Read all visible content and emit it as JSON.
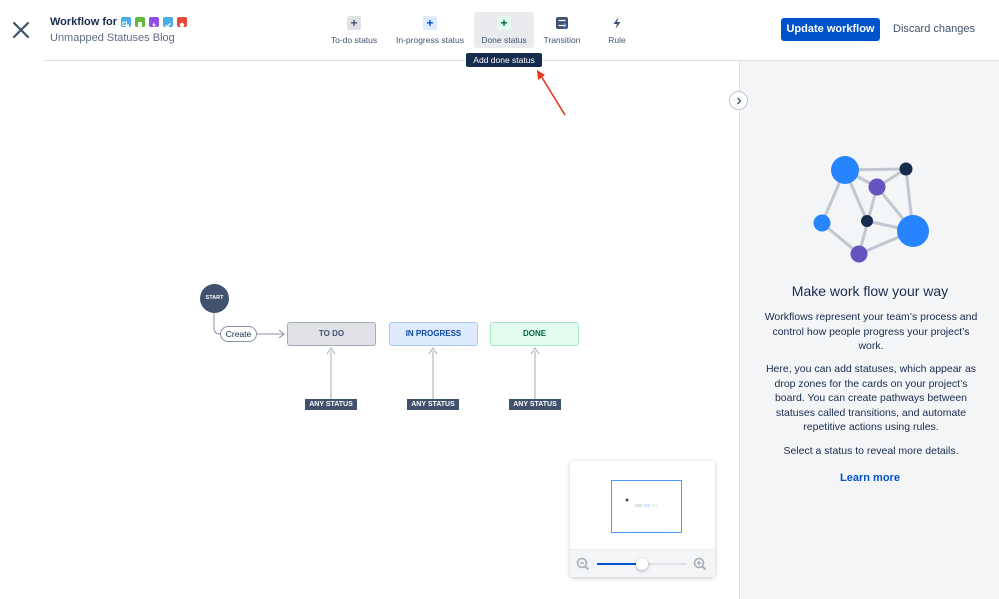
{
  "header": {
    "title": "Workflow for",
    "subtitle": "Unmapped Statuses Blog",
    "issue_type_icons": [
      {
        "name": "subtask-icon",
        "color": "#4bade8"
      },
      {
        "name": "story-icon",
        "color": "#63ba3c"
      },
      {
        "name": "epic-icon",
        "color": "#904ee2"
      },
      {
        "name": "task-icon",
        "color": "#4bade8"
      },
      {
        "name": "bug-icon",
        "color": "#e5493a"
      }
    ]
  },
  "toolbar": {
    "items": [
      {
        "label": "To-do status",
        "icon": "plus-icon"
      },
      {
        "label": "In-progress status",
        "icon": "plus-icon"
      },
      {
        "label": "Done status",
        "icon": "plus-icon"
      },
      {
        "label": "Transition",
        "icon": "transition-icon"
      },
      {
        "label": "Rule",
        "icon": "lightning-icon"
      }
    ],
    "tooltip": "Add done status",
    "update_label": "Update workflow",
    "discard_label": "Discard changes"
  },
  "diagram": {
    "start_label": "START",
    "create_label": "Create",
    "statuses": [
      {
        "label": "TO DO",
        "any_label": "ANY STATUS",
        "category": "todo"
      },
      {
        "label": "IN PROGRESS",
        "any_label": "ANY STATUS",
        "category": "inprogress"
      },
      {
        "label": "DONE",
        "any_label": "ANY STATUS",
        "category": "done"
      }
    ]
  },
  "panel": {
    "heading": "Make work flow your way",
    "paragraphs": [
      "Workflows represent your team’s process and control how people progress your project’s work.",
      "Here, you can add statuses, which appear as drop zones for the cards on your project’s board. You can create pathways between statuses called transitions, and automate repetitive actions using rules.",
      "Select a status to reveal more details."
    ],
    "learn_more": "Learn more"
  },
  "minimap": {
    "zoom_level": 0.5
  },
  "colors": {
    "accent": "#0052cc",
    "todo_bg": "#dfe1e6",
    "inprogress_bg": "#deebff",
    "done_bg": "#e3fcef"
  }
}
